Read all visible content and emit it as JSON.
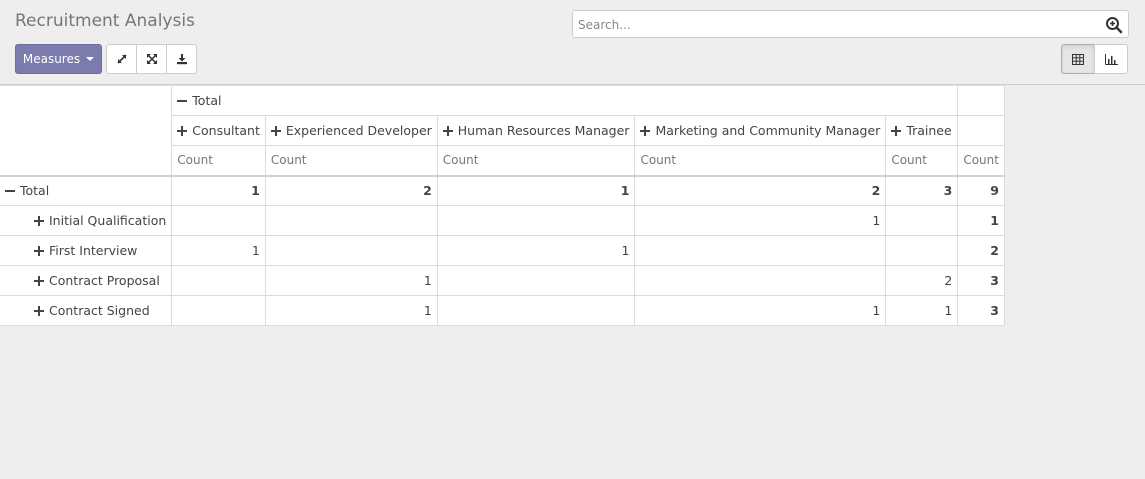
{
  "header": {
    "title": "Recruitment Analysis",
    "search_placeholder": "Search...",
    "measures_label": "Measures"
  },
  "icons": {
    "search": "search-zoom-icon",
    "flip_axis": "flip-axis-icon",
    "expand_all": "expand-all-icon",
    "download": "download-icon",
    "pivot_view": "table-icon",
    "graph_view": "bar-chart-icon"
  },
  "colors": {
    "primary": "#7c7bad",
    "background": "#efeded"
  },
  "pivot": {
    "col_total_label": "Total",
    "row_total_label": "Total",
    "measure": "Count",
    "columns": [
      "Consultant",
      "Experienced Developer",
      "Human Resources Manager",
      "Marketing and Community Manager",
      "Trainee"
    ],
    "grand_total": [
      "1",
      "2",
      "1",
      "2",
      "3",
      "9"
    ],
    "rows": [
      {
        "label": "Initial Qualification",
        "values": [
          "",
          "",
          "",
          "1",
          "",
          "1"
        ]
      },
      {
        "label": "First Interview",
        "values": [
          "1",
          "",
          "1",
          "",
          "",
          "2"
        ]
      },
      {
        "label": "Contract Proposal",
        "values": [
          "",
          "1",
          "",
          "",
          "2",
          "3"
        ]
      },
      {
        "label": "Contract Signed",
        "values": [
          "",
          "1",
          "",
          "1",
          "1",
          "3"
        ]
      }
    ]
  }
}
